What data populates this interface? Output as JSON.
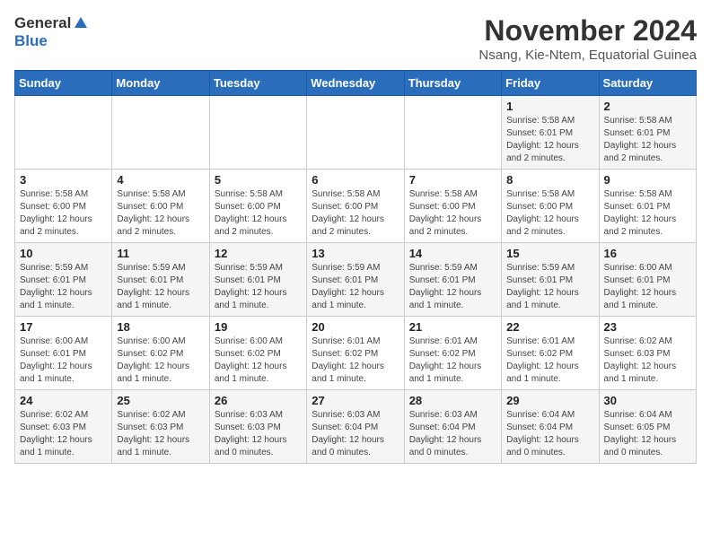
{
  "header": {
    "logo_general": "General",
    "logo_blue": "Blue",
    "month_title": "November 2024",
    "subtitle": "Nsang, Kie-Ntem, Equatorial Guinea"
  },
  "columns": [
    "Sunday",
    "Monday",
    "Tuesday",
    "Wednesday",
    "Thursday",
    "Friday",
    "Saturday"
  ],
  "weeks": [
    {
      "days": [
        {
          "num": "",
          "info": ""
        },
        {
          "num": "",
          "info": ""
        },
        {
          "num": "",
          "info": ""
        },
        {
          "num": "",
          "info": ""
        },
        {
          "num": "",
          "info": ""
        },
        {
          "num": "1",
          "info": "Sunrise: 5:58 AM\nSunset: 6:01 PM\nDaylight: 12 hours and 2 minutes."
        },
        {
          "num": "2",
          "info": "Sunrise: 5:58 AM\nSunset: 6:01 PM\nDaylight: 12 hours and 2 minutes."
        }
      ]
    },
    {
      "days": [
        {
          "num": "3",
          "info": "Sunrise: 5:58 AM\nSunset: 6:00 PM\nDaylight: 12 hours and 2 minutes."
        },
        {
          "num": "4",
          "info": "Sunrise: 5:58 AM\nSunset: 6:00 PM\nDaylight: 12 hours and 2 minutes."
        },
        {
          "num": "5",
          "info": "Sunrise: 5:58 AM\nSunset: 6:00 PM\nDaylight: 12 hours and 2 minutes."
        },
        {
          "num": "6",
          "info": "Sunrise: 5:58 AM\nSunset: 6:00 PM\nDaylight: 12 hours and 2 minutes."
        },
        {
          "num": "7",
          "info": "Sunrise: 5:58 AM\nSunset: 6:00 PM\nDaylight: 12 hours and 2 minutes."
        },
        {
          "num": "8",
          "info": "Sunrise: 5:58 AM\nSunset: 6:00 PM\nDaylight: 12 hours and 2 minutes."
        },
        {
          "num": "9",
          "info": "Sunrise: 5:58 AM\nSunset: 6:01 PM\nDaylight: 12 hours and 2 minutes."
        }
      ]
    },
    {
      "days": [
        {
          "num": "10",
          "info": "Sunrise: 5:59 AM\nSunset: 6:01 PM\nDaylight: 12 hours and 1 minute."
        },
        {
          "num": "11",
          "info": "Sunrise: 5:59 AM\nSunset: 6:01 PM\nDaylight: 12 hours and 1 minute."
        },
        {
          "num": "12",
          "info": "Sunrise: 5:59 AM\nSunset: 6:01 PM\nDaylight: 12 hours and 1 minute."
        },
        {
          "num": "13",
          "info": "Sunrise: 5:59 AM\nSunset: 6:01 PM\nDaylight: 12 hours and 1 minute."
        },
        {
          "num": "14",
          "info": "Sunrise: 5:59 AM\nSunset: 6:01 PM\nDaylight: 12 hours and 1 minute."
        },
        {
          "num": "15",
          "info": "Sunrise: 5:59 AM\nSunset: 6:01 PM\nDaylight: 12 hours and 1 minute."
        },
        {
          "num": "16",
          "info": "Sunrise: 6:00 AM\nSunset: 6:01 PM\nDaylight: 12 hours and 1 minute."
        }
      ]
    },
    {
      "days": [
        {
          "num": "17",
          "info": "Sunrise: 6:00 AM\nSunset: 6:01 PM\nDaylight: 12 hours and 1 minute."
        },
        {
          "num": "18",
          "info": "Sunrise: 6:00 AM\nSunset: 6:02 PM\nDaylight: 12 hours and 1 minute."
        },
        {
          "num": "19",
          "info": "Sunrise: 6:00 AM\nSunset: 6:02 PM\nDaylight: 12 hours and 1 minute."
        },
        {
          "num": "20",
          "info": "Sunrise: 6:01 AM\nSunset: 6:02 PM\nDaylight: 12 hours and 1 minute."
        },
        {
          "num": "21",
          "info": "Sunrise: 6:01 AM\nSunset: 6:02 PM\nDaylight: 12 hours and 1 minute."
        },
        {
          "num": "22",
          "info": "Sunrise: 6:01 AM\nSunset: 6:02 PM\nDaylight: 12 hours and 1 minute."
        },
        {
          "num": "23",
          "info": "Sunrise: 6:02 AM\nSunset: 6:03 PM\nDaylight: 12 hours and 1 minute."
        }
      ]
    },
    {
      "days": [
        {
          "num": "24",
          "info": "Sunrise: 6:02 AM\nSunset: 6:03 PM\nDaylight: 12 hours and 1 minute."
        },
        {
          "num": "25",
          "info": "Sunrise: 6:02 AM\nSunset: 6:03 PM\nDaylight: 12 hours and 1 minute."
        },
        {
          "num": "26",
          "info": "Sunrise: 6:03 AM\nSunset: 6:03 PM\nDaylight: 12 hours and 0 minutes."
        },
        {
          "num": "27",
          "info": "Sunrise: 6:03 AM\nSunset: 6:04 PM\nDaylight: 12 hours and 0 minutes."
        },
        {
          "num": "28",
          "info": "Sunrise: 6:03 AM\nSunset: 6:04 PM\nDaylight: 12 hours and 0 minutes."
        },
        {
          "num": "29",
          "info": "Sunrise: 6:04 AM\nSunset: 6:04 PM\nDaylight: 12 hours and 0 minutes."
        },
        {
          "num": "30",
          "info": "Sunrise: 6:04 AM\nSunset: 6:05 PM\nDaylight: 12 hours and 0 minutes."
        }
      ]
    }
  ]
}
